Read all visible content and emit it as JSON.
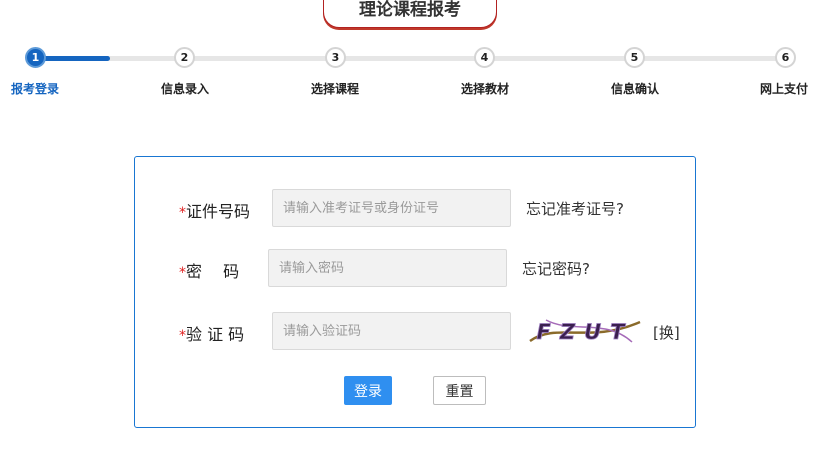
{
  "header": {
    "title": "理论课程报考"
  },
  "steps": [
    {
      "number": "1",
      "label": "报考登录"
    },
    {
      "number": "2",
      "label": "信息录入"
    },
    {
      "number": "3",
      "label": "选择课程"
    },
    {
      "number": "4",
      "label": "选择教材"
    },
    {
      "number": "5",
      "label": "信息确认"
    },
    {
      "number": "6",
      "label": "网上支付"
    }
  ],
  "progress": {
    "current_step": 1,
    "total_steps": 6
  },
  "form": {
    "required_mark": "*",
    "id_label": "证件号码",
    "id_placeholder": "请输入准考证号或身份证号",
    "forgot_id": "忘记准考证号?",
    "password_label": "密　 码",
    "password_placeholder": "请输入密码",
    "forgot_password": "忘记密码?",
    "captcha_label": "验 证 码",
    "captcha_placeholder": "请输入验证码",
    "captcha_text": "FZUT",
    "refresh_captcha": "[换]",
    "login_button": "登录",
    "reset_button": "重置"
  },
  "colors": {
    "accent": "#1565c0",
    "required": "#e02020",
    "button": "#2f8ff0"
  }
}
